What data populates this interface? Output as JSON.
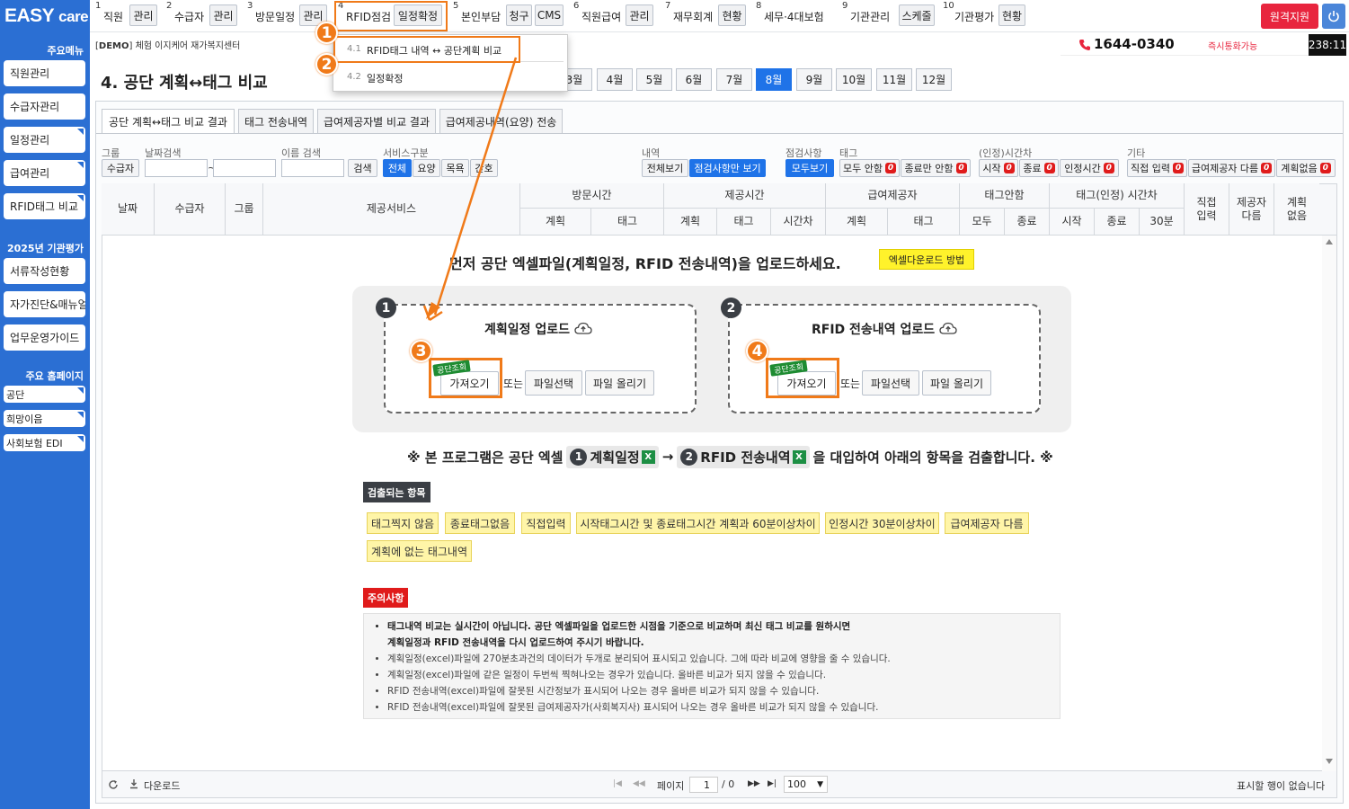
{
  "brand": {
    "logo_text": "EASY",
    "logo_care": "care"
  },
  "sidebar": {
    "section1": "주요메뉴",
    "items": [
      "직원관리",
      "수급자관리",
      "일정관리",
      "급여관리",
      "RFID태그 비교"
    ],
    "section2": "2025년 기관평가",
    "items2": [
      "서류작성현황",
      "자가진단&매뉴얼",
      "업무운영가이드"
    ],
    "section3": "주요 홈페이지",
    "items3": [
      "공단",
      "희망이음",
      "사회보험 EDI"
    ]
  },
  "topmenu": [
    {
      "num": "1",
      "name": "직원",
      "btn": "관리"
    },
    {
      "num": "2",
      "name": "수급자",
      "btn": "관리"
    },
    {
      "num": "3",
      "name": "방문일정",
      "btn": "관리"
    },
    {
      "num": "4",
      "name": "RFID점검",
      "btn": "일정확정"
    },
    {
      "num": "5",
      "name": "본인부담",
      "btn": "청구",
      "btn2": "CMS"
    },
    {
      "num": "6",
      "name": "직원급여",
      "btn": "관리"
    },
    {
      "num": "7",
      "name": "재무회계",
      "btn": "현황"
    },
    {
      "num": "8",
      "name": "세무·4대보험"
    },
    {
      "num": "9",
      "name": "기관관리",
      "btn": "스케줄"
    },
    {
      "num": "10",
      "name": "기관평가",
      "btn": "현황"
    }
  ],
  "header": {
    "remote_button": "원격지원",
    "demo_tag": "DEMO",
    "center_name": "체험 이지케어 재가복지센터",
    "phone": "1644-0340",
    "phone_note": "즉시통화가능",
    "timer": "238:11"
  },
  "dropdown": {
    "items": [
      {
        "num": "4.1",
        "label": "RFID태그 내역 ↔ 공단계획 비교"
      },
      {
        "num": "4.2",
        "label": "일정확정"
      }
    ]
  },
  "page": {
    "title": "4. 공단 계획↔태그 비교"
  },
  "months": [
    "3월",
    "4월",
    "5월",
    "6월",
    "7월",
    "8월",
    "9월",
    "10월",
    "11월",
    "12월"
  ],
  "active_month": "8월",
  "tabs": [
    "공단 계획↔태그 비교 결과",
    "태그 전송내역",
    "급여제공자별 비교 결과",
    "급여제공내역(요양) 전송"
  ],
  "filters": {
    "group_label": "그룹",
    "group_btn": "수급자",
    "date_label": "날짜검색",
    "date_sep": "~",
    "name_label": "이름 검색",
    "search_btn": "검색",
    "service_label": "서비스구분",
    "service_opts": [
      "전체",
      "요양",
      "목욕",
      "간호"
    ],
    "detail_label": "내역",
    "detail_opts": [
      "전체보기",
      "점검사항만 보기"
    ],
    "check_label": "점검사항",
    "check_btn": "모두보기",
    "tag_label": "태그",
    "tag_opts": [
      "모두 안함",
      "종료만 안함"
    ],
    "time_label": "(인정)시간차",
    "time_opts": [
      "시작",
      "종료",
      "인정시간"
    ],
    "etc_label": "기타",
    "etc_opts": [
      "직접 입력",
      "급여제공자 다름",
      "계획없음"
    ],
    "zero": "0"
  },
  "grid": {
    "cols": [
      "날짜",
      "수급자",
      "그룹",
      "제공서비스"
    ],
    "g_visit": "방문시간",
    "g_provide": "제공시간",
    "g_giver": "급여제공자",
    "g_tagyn": "태그안함",
    "g_tagtime": "태그(인정) 시간차",
    "sub": [
      "계획",
      "태그",
      "계획",
      "태그",
      "시간차",
      "계획",
      "태그",
      "모두",
      "종료",
      "시작",
      "종료",
      "30분"
    ],
    "c_direct": "직접\n입력",
    "c_diff": "제공자\n다름",
    "c_noplan": "계획\n없음"
  },
  "upload": {
    "headline": "먼저 공단 엑셀파일(계획일정, RFID 전송내역)을 업로드하세요.",
    "howto": "엑셀다운로드 방법",
    "box1_title": "계획일정 업로드",
    "box2_title": "RFID 전송내역 업로드",
    "fetch": "가져오기",
    "tag": "공단조회",
    "or": "또는",
    "select": "파일선택",
    "upload": "파일 올리기"
  },
  "program_note": {
    "prefix": "※ 본 프로그램은 공단 엑셀",
    "item1": "계획일정",
    "arrow": "→",
    "item2": "RFID 전송내역",
    "suffix": "을 대입하여 아래의 항목을 검출합니다. ※"
  },
  "detect": {
    "title": "검출되는 항목",
    "items": [
      "태그찍지 않음",
      "종료태그없음",
      "직접입력",
      "시작태그시간 및 종료태그시간 계획과 60분이상차이",
      "인정시간 30분이상차이",
      "급여제공자 다름",
      "계획에 없는 태그내역"
    ]
  },
  "caution": {
    "title": "주의사항",
    "bold1": "태그내역 비교는 실시간이 아닙니다. 공단 엑셀파일을 업로드한 시점을 기준으로 비교하며 최신 태그 비교를 원하시면",
    "bold2": "계획일정과 RFID 전송내역을 다시 업로드하여 주시기 바랍니다.",
    "lines": [
      "계획일정(excel)파일에 270분초과건의 데이터가 두개로 분리되어 표시되고 있습니다. 그에 따라 비교에 영향을 줄 수 있습니다.",
      "계획일정(excel)파일에 같은 일정이 두번씩 찍혀나오는 경우가 있습니다. 올바른 비교가 되지 않을 수 있습니다.",
      "RFID 전송내역(excel)파일에 잘못된 시간정보가 표시되어 나오는 경우 올바른 비교가 되지 않을 수 있습니다.",
      "RFID 전송내역(excel)파일에 잘못된 급여제공자가(사회복지사) 표시되어 나오는 경우 올바른 비교가 되지 않을 수 있습니다."
    ]
  },
  "pager": {
    "download": "다운로드",
    "page_label": "페이지",
    "page_value": "1",
    "page_total": "/ 0",
    "rows": "100",
    "empty": "표시할 행이 없습니다"
  },
  "callouts": [
    "1",
    "2",
    "3",
    "4"
  ],
  "colors": {
    "accent": "#2b6fd3",
    "orange": "#f07a19",
    "active": "#1f73e8",
    "red": "#e01b1b",
    "remote": "#e8253e"
  }
}
